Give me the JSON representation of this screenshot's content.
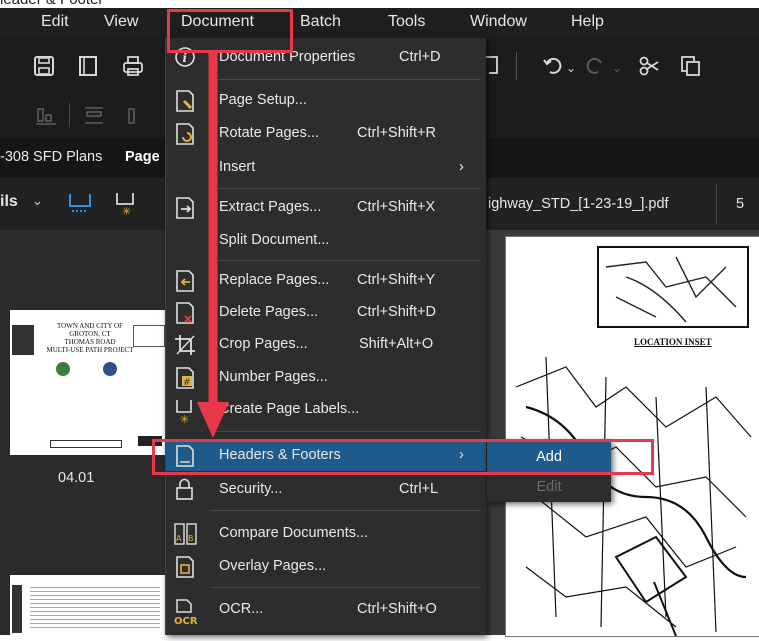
{
  "top_text": "leader & Footer",
  "menubar": {
    "items": [
      "Edit",
      "View",
      "Document",
      "Batch",
      "Tools",
      "Window",
      "Help"
    ]
  },
  "tab_strip": {
    "left_label": "-308 SFD Plans",
    "left_label_cut": "Page",
    "file_tab": "ighway_STD_[1-23-19_].pdf",
    "file_tab_extra": "5"
  },
  "sidebar": {
    "label": "ils",
    "thumb_caption": "04.01",
    "thumb_text": [
      "TOWN AND CITY OF",
      "GROTON, CT",
      "THOMAS ROAD",
      "MULTI-USE PATH PROJECT"
    ]
  },
  "document": {
    "map_title": "LOCATION INSET"
  },
  "menu": {
    "items": [
      {
        "label": "Document Properties",
        "shortcut": "Ctrl+D",
        "icon": "info-icon"
      },
      {
        "label": "Page Setup...",
        "shortcut": "",
        "icon": "page-setup-icon"
      },
      {
        "label": "Rotate Pages...",
        "shortcut": "Ctrl+Shift+R",
        "icon": "rotate-pages-icon"
      },
      {
        "label": "Insert",
        "shortcut": "",
        "icon": "",
        "submenu": true
      },
      {
        "label": "Extract Pages...",
        "shortcut": "Ctrl+Shift+X",
        "icon": "extract-pages-icon"
      },
      {
        "label": "Split Document...",
        "shortcut": "",
        "icon": ""
      },
      {
        "label": "Replace Pages...",
        "shortcut": "Ctrl+Shift+Y",
        "icon": "replace-pages-icon"
      },
      {
        "label": "Delete Pages...",
        "shortcut": "Ctrl+Shift+D",
        "icon": "delete-pages-icon"
      },
      {
        "label": "Crop Pages...",
        "shortcut": "Shift+Alt+O",
        "icon": "crop-pages-icon"
      },
      {
        "label": "Number Pages...",
        "shortcut": "",
        "icon": "number-pages-icon"
      },
      {
        "label": "Create Page Labels...",
        "shortcut": "",
        "icon": "page-labels-icon"
      },
      {
        "label": "Headers & Footers",
        "shortcut": "",
        "icon": "headers-footers-icon",
        "submenu": true
      },
      {
        "label": "Security...",
        "shortcut": "Ctrl+L",
        "icon": "lock-icon"
      },
      {
        "label": "Compare Documents...",
        "shortcut": "",
        "icon": "compare-documents-icon"
      },
      {
        "label": "Overlay Pages...",
        "shortcut": "",
        "icon": "overlay-pages-icon"
      },
      {
        "label": "OCR...",
        "shortcut": "Ctrl+Shift+O",
        "icon": "ocr-icon"
      }
    ]
  },
  "submenu": {
    "items": [
      {
        "label": "Add",
        "enabled": true
      },
      {
        "label": "Edit",
        "enabled": false
      }
    ]
  },
  "colors": {
    "highlight": "#1e5a8a",
    "annotation_red": "#e8394a"
  }
}
